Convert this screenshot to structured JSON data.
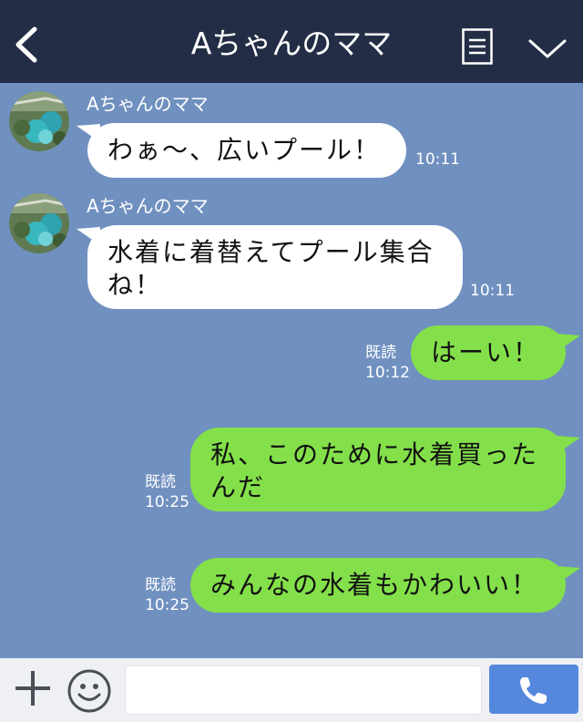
{
  "header": {
    "title": "Aちゃんのママ"
  },
  "messages": [
    {
      "direction": "in",
      "sender": "Aちゃんのママ",
      "text_lines": [
        "わぁ〜、広いプール！"
      ],
      "time": "10:11"
    },
    {
      "direction": "in",
      "sender": "Aちゃんのママ",
      "text_lines": [
        "水着に着替えてプール集合",
        "ね！"
      ],
      "time": "10:11"
    },
    {
      "direction": "out",
      "read": "既読",
      "time": "10:12",
      "text_lines": [
        "はーい！"
      ]
    },
    {
      "direction": "out",
      "read": "既読",
      "time": "10:25",
      "text_lines": [
        "私、このために水着買った",
        "んだ"
      ]
    },
    {
      "direction": "out",
      "read": "既読",
      "time": "10:25",
      "text_lines": [
        "みんなの水着もかわいい！"
      ]
    }
  ],
  "footer": {
    "input_value": ""
  },
  "colors": {
    "header_bg": "#232e46",
    "chat_bg": "#7090c0",
    "incoming_bubble": "#ffffff",
    "outgoing_bubble": "#84e04a",
    "call_button": "#5588dd"
  },
  "icons": [
    "back-icon",
    "memo-icon",
    "chevron-down-icon",
    "plus-icon",
    "emoji-icon",
    "phone-icon"
  ]
}
